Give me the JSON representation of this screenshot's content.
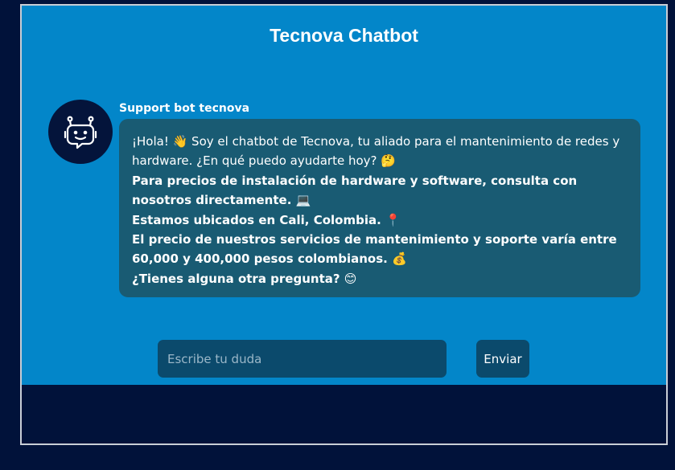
{
  "header": {
    "title": "Tecnova Chatbot"
  },
  "bot": {
    "name": "Support bot tecnova",
    "avatar_icon": "robot-face-icon"
  },
  "message": {
    "lines": [
      {
        "text": "¡Hola! 👋 Soy el chatbot de Tecnova, tu aliado para el mantenimiento de redes y hardware. ¿En qué puedo ayudarte hoy? 🤔",
        "bold": false
      },
      {
        "text": "Para precios de instalación de hardware y software, consulta con nosotros directamente. 💻",
        "bold": true
      },
      {
        "text": "Estamos ubicados en Cali, Colombia. 📍",
        "bold": true
      },
      {
        "text": "El precio de nuestros servicios de mantenimiento y soporte varía entre 60,000 y 400,000 pesos colombianos. 💰",
        "bold": true
      },
      {
        "text": "¿Tienes alguna otra pregunta? 😊",
        "bold": true
      }
    ]
  },
  "composer": {
    "placeholder": "Escribe tu duda",
    "value": "",
    "send_label": "Enviar"
  },
  "colors": {
    "page_background": "#01123a",
    "panel_background": "#0386c9",
    "bubble_background": "#195b73",
    "input_background": "#0b4a6c"
  }
}
